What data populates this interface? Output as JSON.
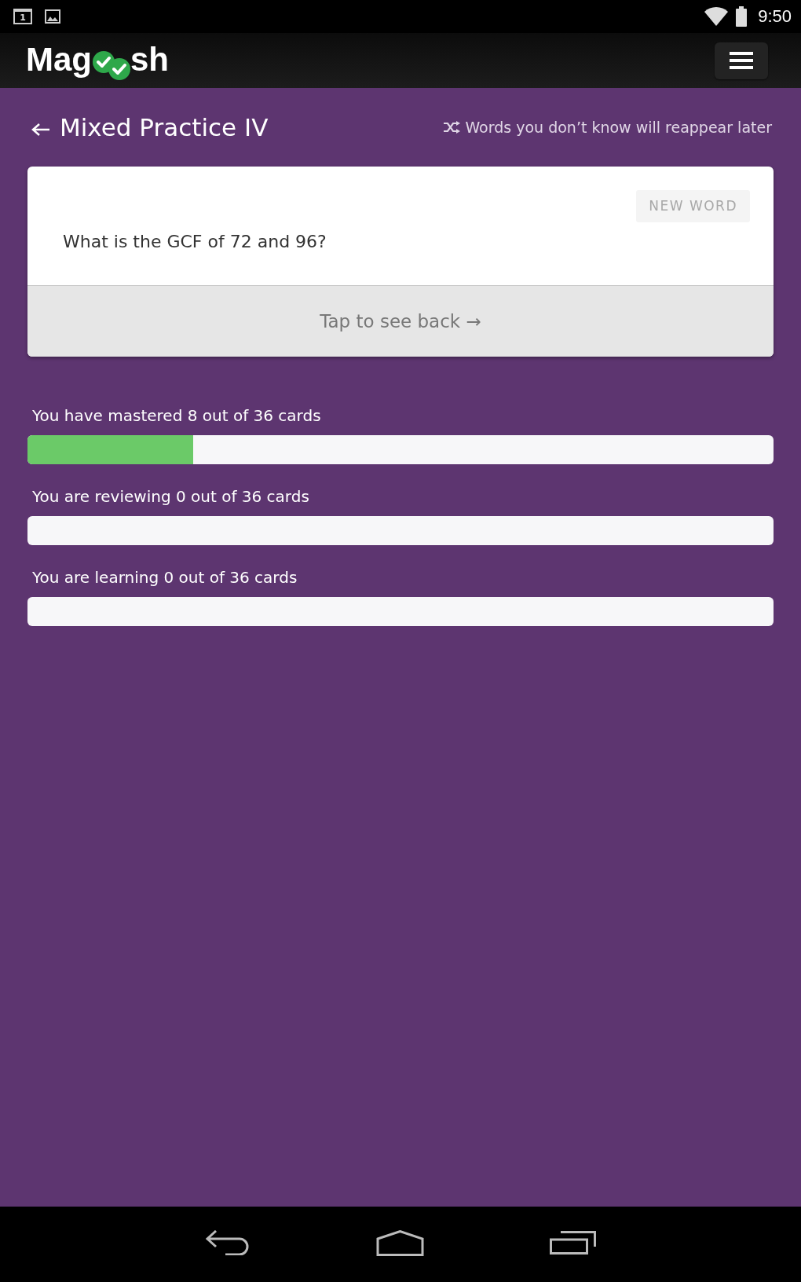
{
  "status_bar": {
    "notifications": [
      {
        "kind": "calendar",
        "text": "1"
      },
      {
        "kind": "image"
      }
    ],
    "time": "9:50"
  },
  "header": {
    "logo": {
      "prefix": "Mag",
      "suffix": "sh"
    }
  },
  "page": {
    "title": "Mixed Practice IV",
    "hint": "Words you don’t know will reappear later"
  },
  "card": {
    "badge": "NEW WORD",
    "question": "What is the GCF of 72 and 96?",
    "flip_label": "Tap to see back →"
  },
  "progress": [
    {
      "label": "You have mastered 8 out of 36 cards",
      "level": 0.2222
    },
    {
      "label": "You are reviewing 0 out of 36 cards",
      "level": 0
    },
    {
      "label": "You are learning 0 out of 36 cards",
      "level": 0
    }
  ]
}
